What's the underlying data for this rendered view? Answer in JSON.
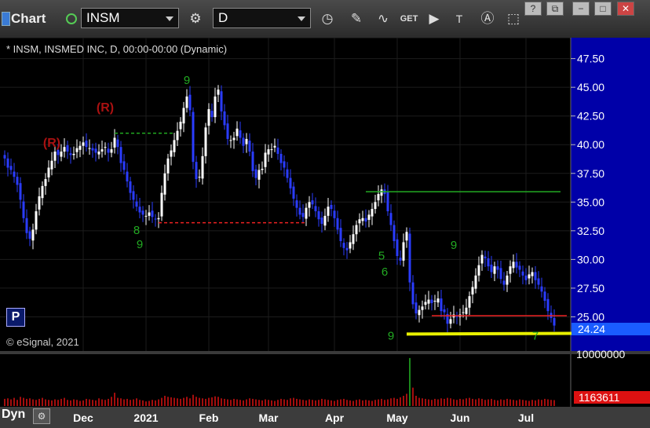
{
  "toolbar": {
    "title": "Chart",
    "symbol": "INSM",
    "interval": "D",
    "tool_icons": [
      "settings-gear-icon",
      "clock-icon",
      "pencil-icon",
      "curve-icon",
      "get-icon",
      "play-icon",
      "text-icon",
      "alert-icon",
      "cursor-icon"
    ],
    "get_label": "GET"
  },
  "legend_text": "* INSM, INSMED INC, D, 00:00-00:00 (Dynamic)",
  "copyright": "© eSignal, 2021",
  "p_label": "P",
  "dyn_label": "Dyn",
  "colors": {
    "background": "#000000",
    "price_axis": "#0000a8",
    "up_candle": "#ffffff",
    "down_candle": "#2a3cff",
    "volume": "#cc1111",
    "support_line": "#e8f000",
    "resistance_line_red": "#ee2222",
    "resistance_line_green": "#22aa22",
    "sequential_label": "#22aa22",
    "r_label": "#aa1111"
  },
  "chart_data": {
    "type": "candlestick",
    "price_ticks": [
      "47.50",
      "45.00",
      "42.50",
      "40.00",
      "37.50",
      "35.00",
      "32.50",
      "30.00",
      "27.50",
      "25.00"
    ],
    "price_range": [
      22.5,
      48.5
    ],
    "last_price_label": "24.24",
    "volume_scale_label": "10000000",
    "volume_last_label": "1163611",
    "volume_range": [
      0,
      10000000
    ],
    "x_labels": [
      {
        "label": "Dec",
        "idx": 25
      },
      {
        "label": "2021",
        "idx": 45
      },
      {
        "label": "Feb",
        "idx": 65
      },
      {
        "label": "Mar",
        "idx": 84
      },
      {
        "label": "Apr",
        "idx": 105
      },
      {
        "label": "May",
        "idx": 125
      },
      {
        "label": "Jun",
        "idx": 145
      },
      {
        "label": "Jul",
        "idx": 166
      }
    ],
    "closes": [
      38.8,
      38.0,
      37.8,
      37.2,
      36.5,
      35.2,
      33.6,
      32.3,
      31.8,
      32.6,
      34.2,
      35.5,
      36.4,
      37.0,
      38.0,
      38.6,
      39.4,
      39.1,
      39.4,
      39.8,
      39.4,
      39.1,
      39.2,
      39.7,
      39.9,
      40.2,
      39.8,
      39.7,
      39.5,
      39.3,
      39.4,
      39.6,
      39.8,
      39.3,
      39.6,
      40.6,
      39.8,
      38.4,
      37.8,
      36.8,
      35.8,
      35.2,
      34.6,
      34.1,
      33.9,
      33.8,
      34.1,
      33.7,
      33.5,
      33.6,
      35.8,
      37.5,
      38.8,
      39.5,
      40.4,
      41.2,
      42.0,
      43.2,
      44.2,
      43.0,
      38.5,
      37.0,
      37.2,
      39.0,
      41.5,
      43.1,
      42.4,
      44.2,
      44.8,
      42.9,
      41.7,
      40.5,
      40.4,
      40.6,
      41.4,
      40.6,
      39.9,
      40.5,
      39.4,
      37.7,
      37.1,
      37.8,
      37.9,
      39.3,
      39.6,
      39.6,
      39.9,
      39.2,
      38.4,
      38.0,
      37.1,
      36.2,
      35.3,
      34.5,
      33.9,
      33.7,
      34.5,
      35.0,
      34.8,
      34.2,
      33.5,
      33.1,
      33.8,
      34.6,
      34.4,
      33.6,
      32.6,
      31.6,
      31.0,
      30.8,
      31.5,
      32.2,
      33.0,
      33.5,
      33.6,
      33.3,
      33.9,
      34.4,
      35.0,
      35.7,
      36.1,
      35.7,
      34.2,
      33.0,
      31.6,
      30.3,
      29.9,
      31.5,
      32.4,
      28.0,
      26.1,
      25.3,
      25.6,
      25.9,
      26.3,
      26.5,
      26.2,
      26.4,
      26.6,
      25.5,
      25.4,
      24.4,
      24.8,
      25.2,
      25.0,
      25.2,
      25.4,
      25.8,
      26.8,
      27.6,
      28.6,
      29.5,
      30.4,
      30.1,
      29.4,
      28.9,
      29.4,
      29.1,
      28.3,
      27.8,
      28.6,
      29.4,
      29.8,
      29.3,
      29.1,
      28.6,
      28.2,
      28.7,
      28.9,
      28.2,
      27.8,
      27.2,
      26.4,
      25.5,
      24.9,
      24.24
    ],
    "volumes": [
      1.4,
      1.5,
      1.3,
      1.6,
      1.2,
      1.8,
      1.6,
      1.4,
      1.5,
      1.3,
      1.2,
      1.4,
      1.6,
      1.3,
      1.2,
      1.1,
      1.3,
      1.2,
      1.4,
      1.6,
      1.2,
      1.1,
      1.3,
      1.2,
      1.0,
      1.1,
      1.4,
      1.3,
      1.2,
      1.1,
      1.5,
      1.3,
      1.2,
      1.4,
      1.8,
      2.6,
      1.6,
      1.5,
      1.3,
      1.4,
      1.2,
      1.3,
      1.5,
      1.2,
      1.1,
      0.9,
      1.0,
      1.2,
      1.1,
      1.3,
      1.6,
      2.0,
      1.8,
      1.7,
      1.6,
      1.5,
      1.4,
      1.6,
      1.8,
      1.5,
      2.2,
      1.8,
      1.6,
      1.5,
      1.4,
      1.6,
      1.7,
      1.9,
      1.8,
      1.5,
      1.4,
      1.3,
      1.2,
      1.4,
      1.3,
      1.2,
      1.1,
      1.3,
      1.5,
      1.4,
      1.3,
      1.2,
      1.1,
      1.3,
      1.2,
      1.1,
      1.0,
      1.2,
      1.4,
      1.3,
      1.2,
      1.5,
      1.6,
      1.4,
      1.3,
      1.2,
      1.1,
      1.3,
      1.2,
      1.1,
      1.2,
      1.4,
      1.3,
      1.2,
      1.1,
      1.0,
      1.2,
      1.3,
      1.4,
      1.2,
      1.1,
      1.0,
      1.2,
      1.3,
      1.1,
      1.2,
      1.1,
      1.0,
      1.2,
      1.3,
      1.4,
      1.2,
      1.3,
      1.5,
      1.6,
      1.4,
      1.7,
      2.0,
      2.4,
      9.4,
      3.6,
      2.0,
      1.6,
      1.5,
      1.4,
      1.3,
      1.2,
      1.4,
      1.3,
      1.5,
      1.4,
      1.6,
      1.5,
      1.3,
      1.2,
      1.4,
      1.3,
      1.5,
      1.6,
      1.4,
      1.3,
      1.5,
      1.4,
      1.2,
      1.3,
      1.4,
      1.2,
      1.1,
      1.3,
      1.2,
      1.4,
      1.3,
      1.2,
      1.1,
      1.3,
      1.2,
      1.1,
      1.0,
      1.2,
      1.1,
      1.3,
      1.2,
      1.4,
      1.3,
      1.2,
      1.16
    ],
    "lines": [
      {
        "kind": "support",
        "price": 23.5,
        "from_idx": 128,
        "to_idx": 182
      },
      {
        "kind": "resistance",
        "color": "red",
        "price": 33.2,
        "from_idx": 49,
        "to_idx": 96
      },
      {
        "kind": "resistance",
        "color": "red",
        "price": 25.1,
        "from_idx": 136,
        "to_idx": 179
      },
      {
        "kind": "resistance",
        "color": "green",
        "price": 41.0,
        "from_idx": 35,
        "to_idx": 54
      },
      {
        "kind": "resistance",
        "color": "green",
        "price": 35.9,
        "from_idx": 115,
        "to_idx": 177
      }
    ],
    "annotations": [
      {
        "text": "(R)",
        "idx": 15,
        "price": 39.8,
        "color": "r"
      },
      {
        "text": "(R)",
        "idx": 32,
        "price": 42.9,
        "color": "r"
      },
      {
        "text": "9",
        "idx": 58,
        "price": 45.3,
        "color": "g"
      },
      {
        "text": "9",
        "idx": 43,
        "price": 31.0,
        "color": "g"
      },
      {
        "text": "8",
        "idx": 42,
        "price": 32.2,
        "color": "g"
      },
      {
        "text": "9",
        "idx": 123,
        "price": 23.0,
        "color": "g"
      },
      {
        "text": "6",
        "idx": 121,
        "price": 28.6,
        "color": "g"
      },
      {
        "text": "5",
        "idx": 120,
        "price": 30.0,
        "color": "g"
      },
      {
        "text": "9",
        "idx": 143,
        "price": 30.9,
        "color": "g"
      },
      {
        "text": "7",
        "idx": 169,
        "price": 23.0,
        "color": "g"
      }
    ]
  }
}
